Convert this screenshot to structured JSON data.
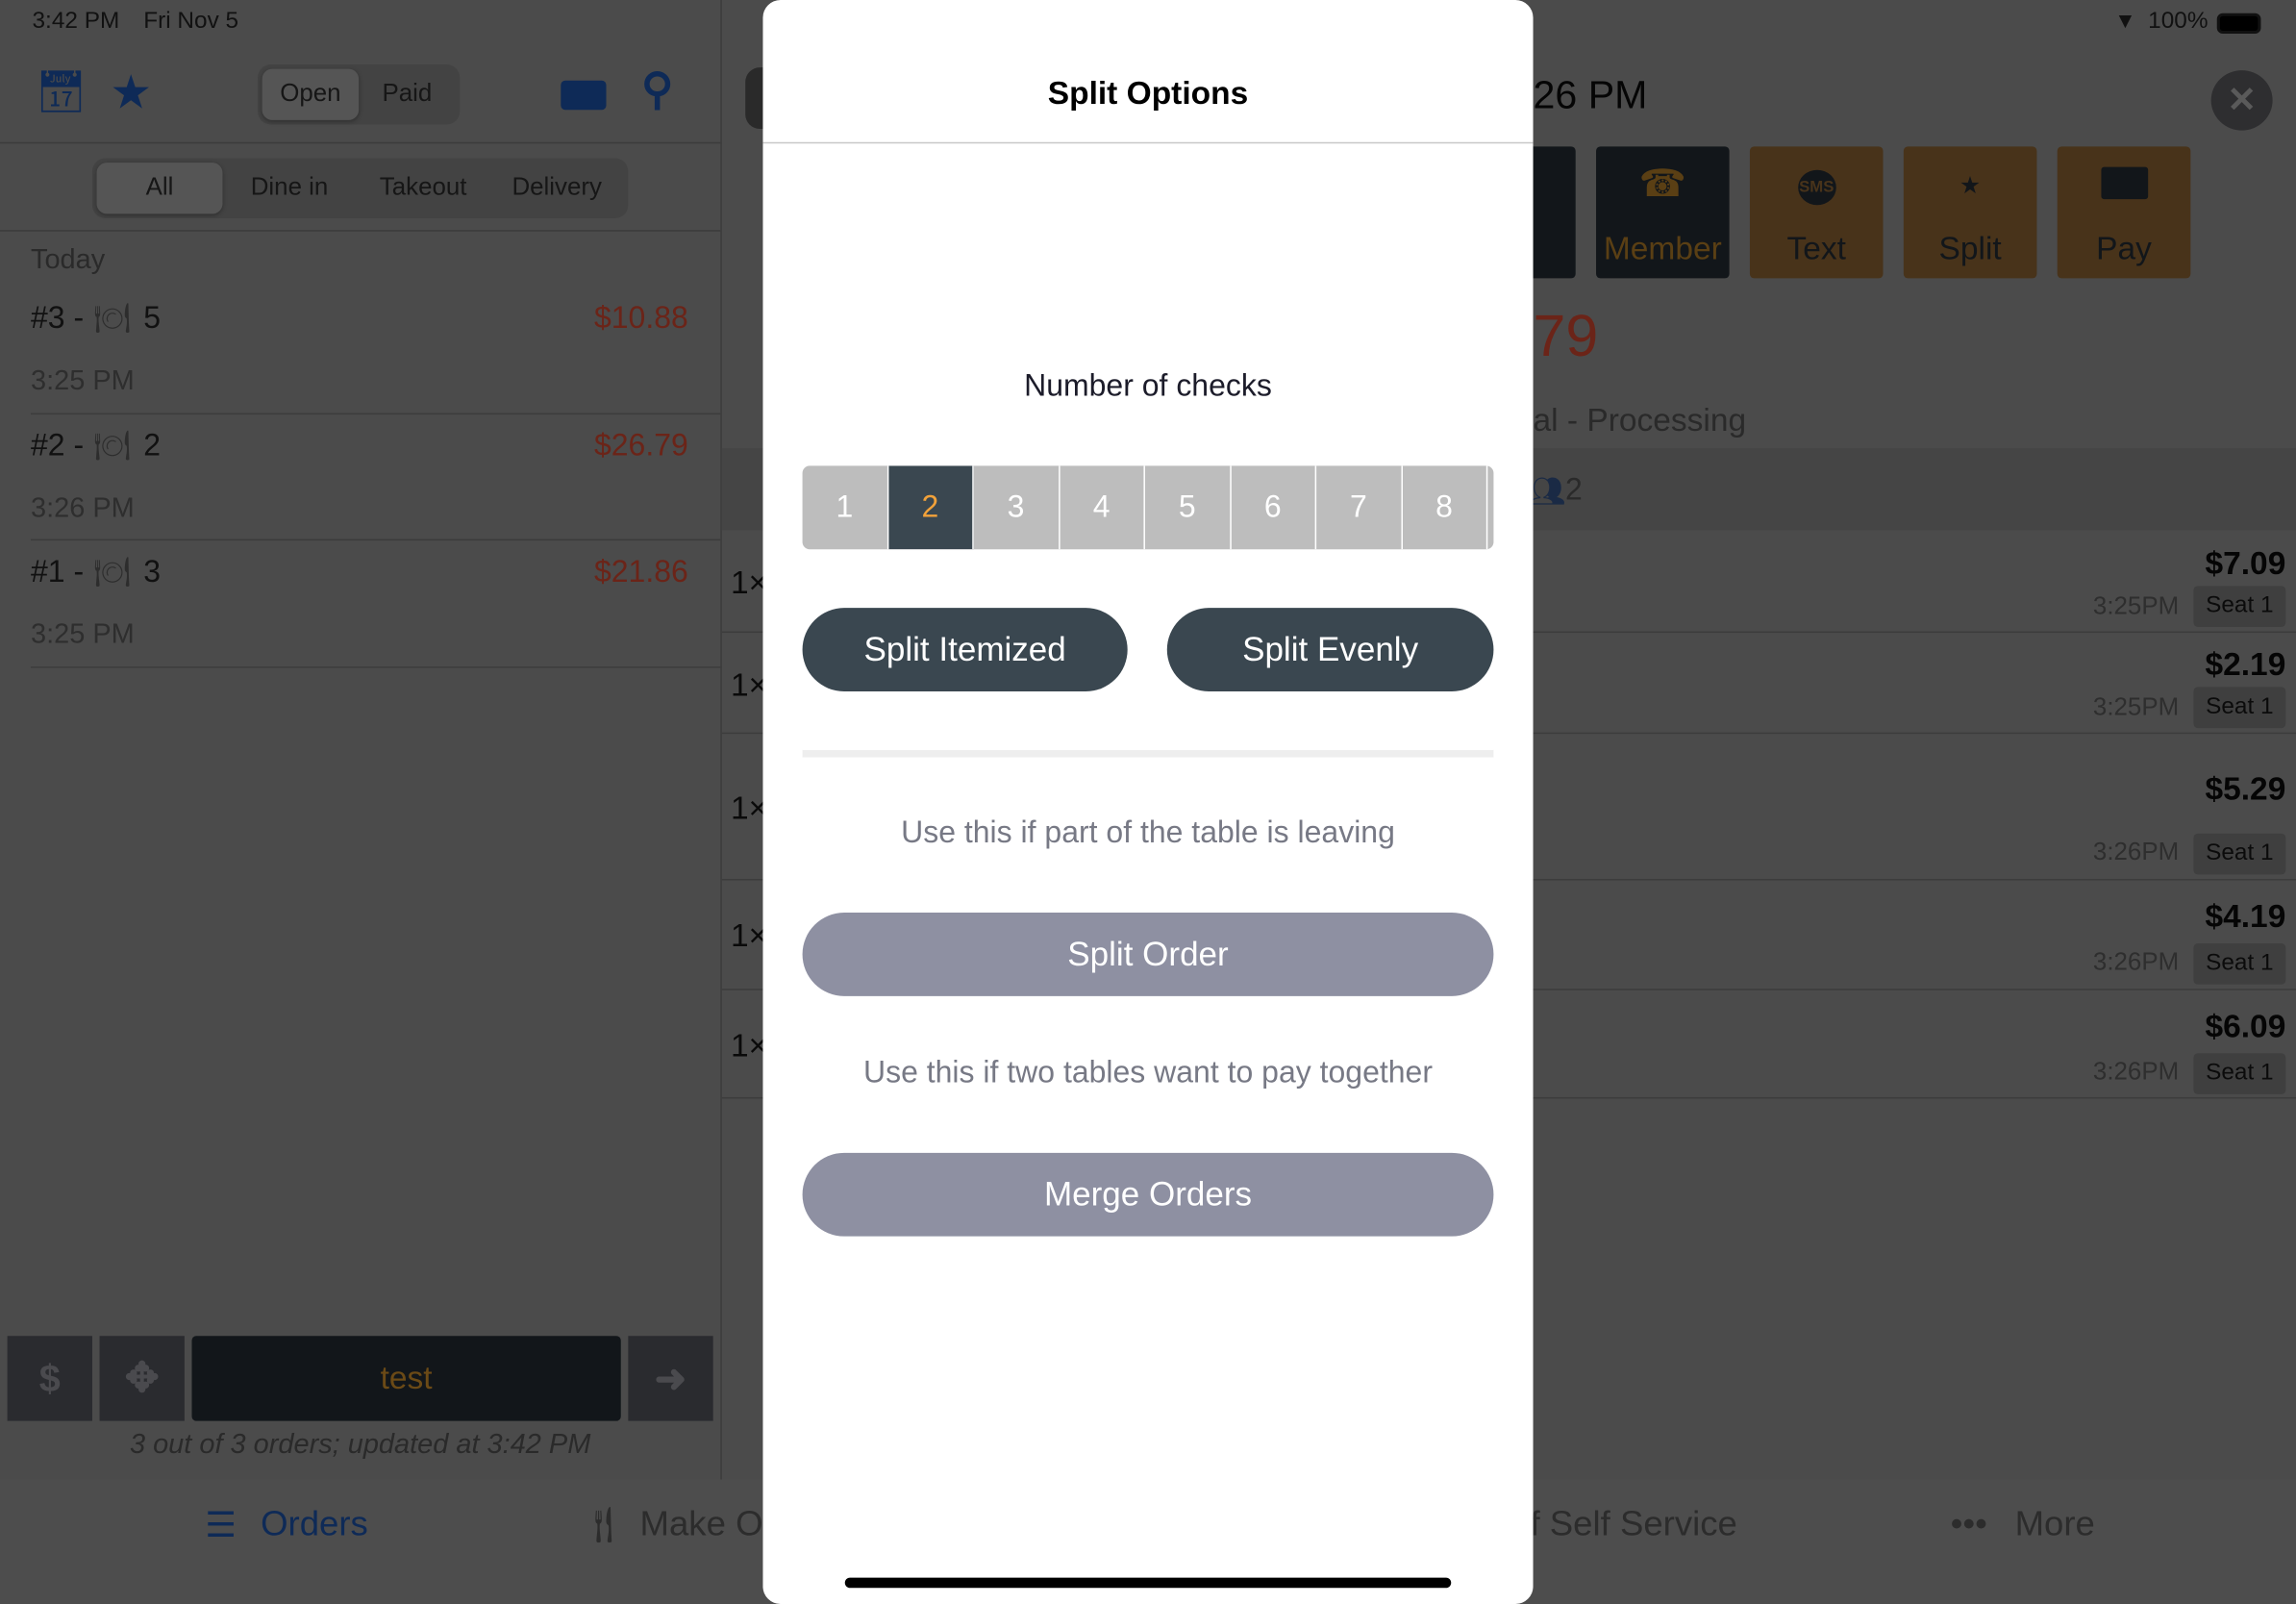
{
  "status_bar": {
    "time": "3:42 PM",
    "date": "Fri Nov 5",
    "battery": "100%"
  },
  "left": {
    "toolbar": {
      "segments": [
        "Open",
        "Paid"
      ],
      "selected": "Open"
    },
    "filters": {
      "items": [
        "All",
        "Dine in",
        "Takeout",
        "Delivery"
      ],
      "selected": "All"
    },
    "section": "Today",
    "orders": [
      {
        "label": "#3 -",
        "table": "5",
        "price": "$10.88",
        "time": "3:25 PM"
      },
      {
        "label": "#2 -",
        "table": "2",
        "price": "$26.79",
        "time": "3:26 PM"
      },
      {
        "label": "#1 -",
        "table": "3",
        "price": "$21.86",
        "time": "3:25 PM"
      }
    ],
    "bottom": {
      "dollar": "$",
      "center": "test",
      "footer": "3 out of 3 orders; updated at 3:42 PM"
    }
  },
  "tabbar": {
    "items": [
      "Orders",
      "Make O",
      "f Self Service",
      "More"
    ],
    "selected": "Orders"
  },
  "right": {
    "header_time": "26 PM",
    "actions": [
      "Member",
      "Text",
      "Split",
      "Pay"
    ],
    "text_icon": "SMS",
    "total": "79",
    "status": "al - Processing",
    "guests": "2",
    "items": [
      {
        "qty": "1×",
        "price": "$7.09",
        "time": "3:25PM",
        "seat": "Seat 1"
      },
      {
        "qty": "1×",
        "price": "$2.19",
        "time": "3:25PM",
        "seat": "Seat 1"
      },
      {
        "qty": "1×",
        "price": "$5.29",
        "time": "3:26PM",
        "seat": "Seat 1"
      },
      {
        "qty": "1×",
        "price": "$4.19",
        "time": "3:26PM",
        "seat": "Seat 1"
      },
      {
        "qty": "1×",
        "price": "$6.09",
        "time": "3:26PM",
        "seat": "Seat 1"
      }
    ]
  },
  "modal": {
    "title": "Split Options",
    "checks_label": "Number of checks",
    "checks": [
      "1",
      "2",
      "3",
      "4",
      "5",
      "6",
      "7",
      "8"
    ],
    "selected_checks": "2",
    "split_itemized": "Split Itemized",
    "split_evenly": "Split Evenly",
    "hint_split": "Use this if part of the table is leaving",
    "split_order": "Split Order",
    "hint_merge": "Use this if two tables want to pay together",
    "merge_orders": "Merge Orders"
  },
  "colors": {
    "accent_blue": "#0e2a57",
    "selected_check_text": "#f2a23a",
    "dark_button": "#3a4750",
    "light_button": "#8e90a2",
    "price_red": "#6b2418"
  }
}
